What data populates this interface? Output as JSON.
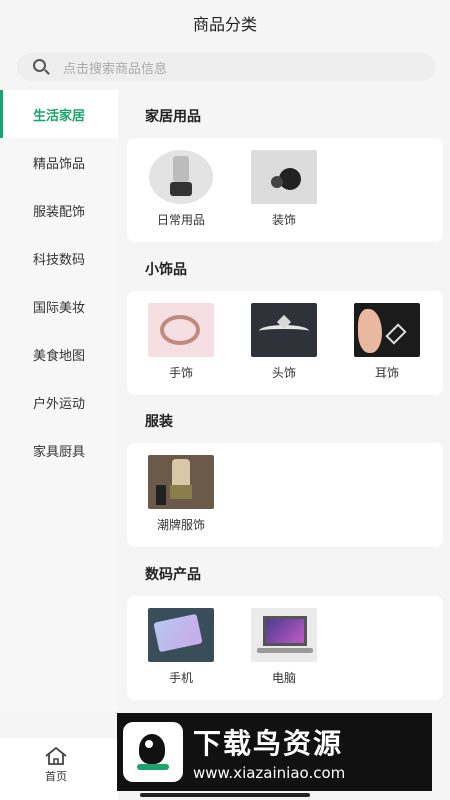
{
  "header": {
    "title": "商品分类"
  },
  "search": {
    "placeholder": "点击搜索商品信息"
  },
  "sidebar": {
    "items": [
      {
        "label": "生活家居",
        "active": true
      },
      {
        "label": "精品饰品",
        "active": false
      },
      {
        "label": "服装配饰",
        "active": false
      },
      {
        "label": "科技数码",
        "active": false
      },
      {
        "label": "国际美妆",
        "active": false
      },
      {
        "label": "美食地图",
        "active": false
      },
      {
        "label": "户外运动",
        "active": false
      },
      {
        "label": "家具厨具",
        "active": false
      }
    ]
  },
  "sections": [
    {
      "title": "家居用品",
      "items": [
        {
          "label": "日常用品"
        },
        {
          "label": "装饰"
        }
      ]
    },
    {
      "title": "小饰品",
      "items": [
        {
          "label": "手饰"
        },
        {
          "label": "头饰"
        },
        {
          "label": "耳饰"
        }
      ]
    },
    {
      "title": "服装",
      "items": [
        {
          "label": "潮牌服饰"
        }
      ]
    },
    {
      "title": "数码产品",
      "items": [
        {
          "label": "手机"
        },
        {
          "label": "电脑"
        }
      ]
    }
  ],
  "bottom_nav": {
    "home_label": "首页"
  },
  "watermark": {
    "title": "下载鸟资源",
    "url": "www.xiazainiao.com"
  },
  "colors": {
    "accent": "#1aa36b",
    "card": "#ffffff",
    "background": "#f5f5f5"
  }
}
